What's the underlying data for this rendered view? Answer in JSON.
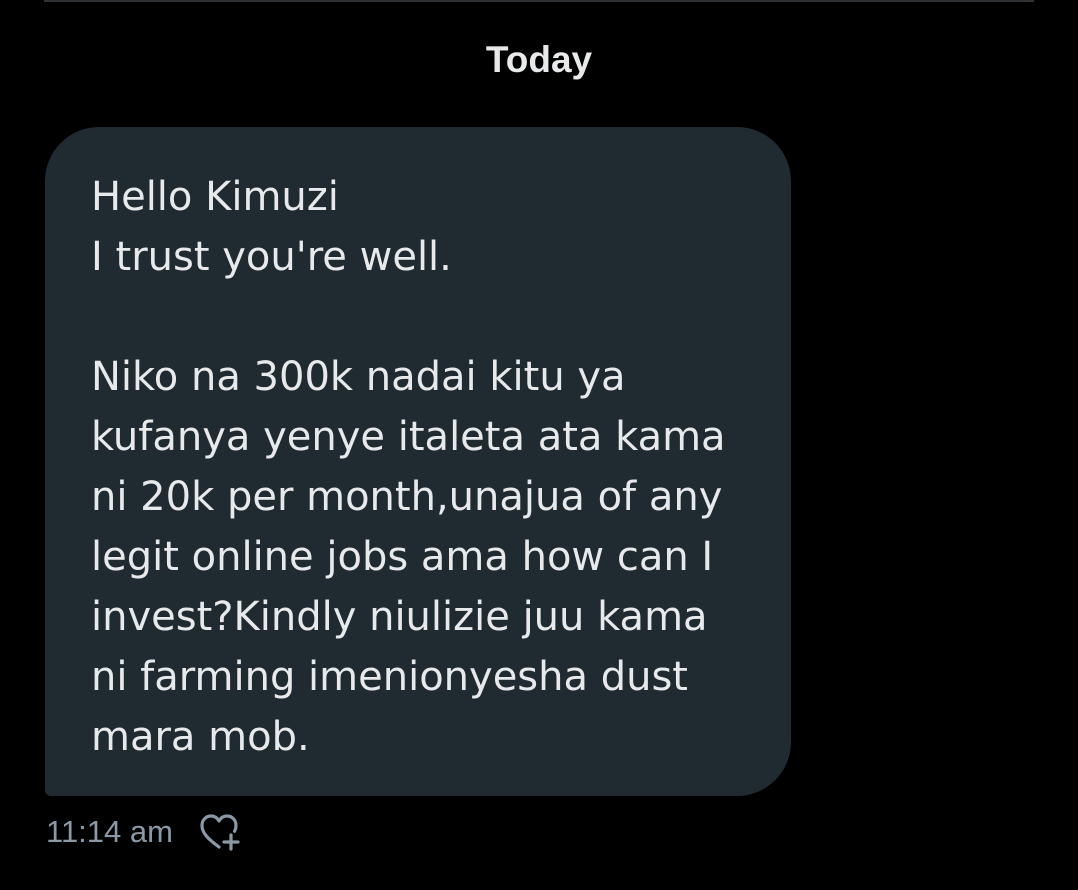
{
  "conversation": {
    "date_separator": "Today"
  },
  "message": {
    "lines": [
      "Hello Kimuzi",
      "I trust you're well.",
      "",
      "Niko na 300k nadai kitu ya",
      "kufanya yenye italeta ata kama",
      "ni 20k per month,unajua of any",
      "legit online jobs ama how can I",
      "invest?Kindly niulizie juu kama",
      "ni farming imenionyesha dust",
      "mara mob."
    ],
    "timestamp": "11:14 am",
    "react_icon": "heart-plus-icon"
  },
  "colors": {
    "background": "#000000",
    "bubble": "#202a31",
    "text": "#e7e9ea",
    "muted": "#8b98a5",
    "divider": "#2f3336"
  }
}
